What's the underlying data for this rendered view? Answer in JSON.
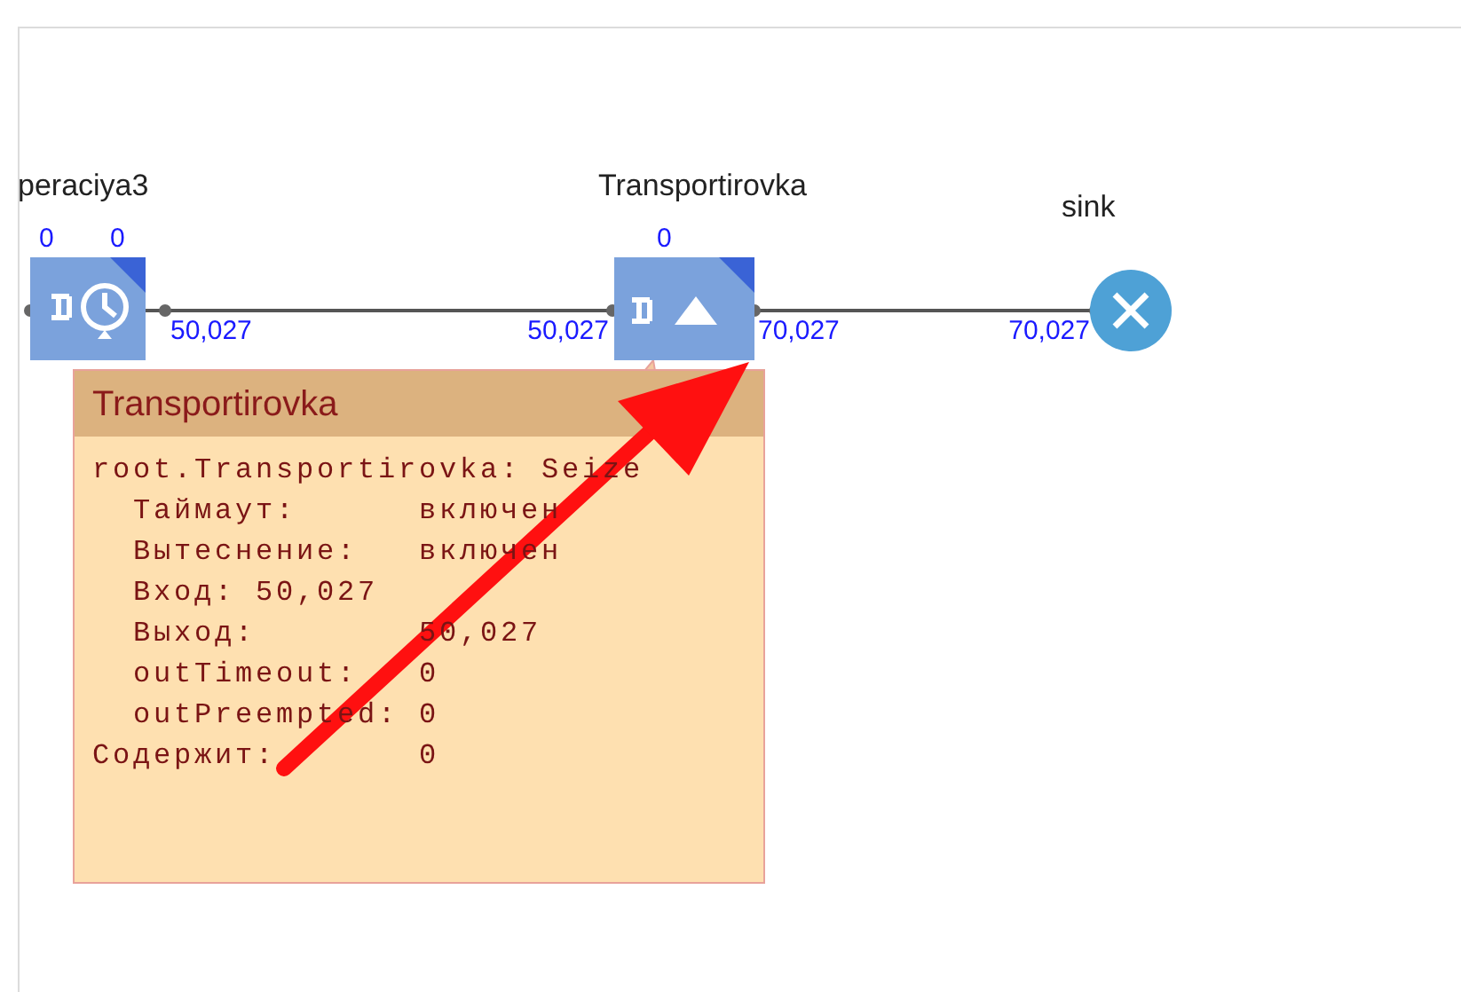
{
  "nodes": [
    {
      "kind": "delay",
      "name": "peraciya3",
      "counts": [
        "0",
        "0"
      ],
      "out_value": "50,027"
    },
    {
      "kind": "seize",
      "name": "Transportirovka",
      "counts": [
        "0"
      ],
      "in_value": "50,027",
      "out_value": "70,027"
    },
    {
      "kind": "sink",
      "name": "sink",
      "in_value": "70,027"
    }
  ],
  "tooltip": {
    "title": "Transportirovka",
    "lines": [
      {
        "text": "root.Transportirovka: Seize",
        "indented": false
      },
      {
        "text": "Таймаут:      включен",
        "indented": true
      },
      {
        "text": "Вытеснение:   включен",
        "indented": true
      },
      {
        "text": "Вход: 50,027",
        "indented": true
      },
      {
        "text": "Выход:        50,027",
        "indented": true
      },
      {
        "text": "outTimeout:   0",
        "indented": true
      },
      {
        "text": "outPreempted: 0",
        "indented": true
      },
      {
        "text": "Содержит:       0",
        "indented": false
      }
    ]
  }
}
